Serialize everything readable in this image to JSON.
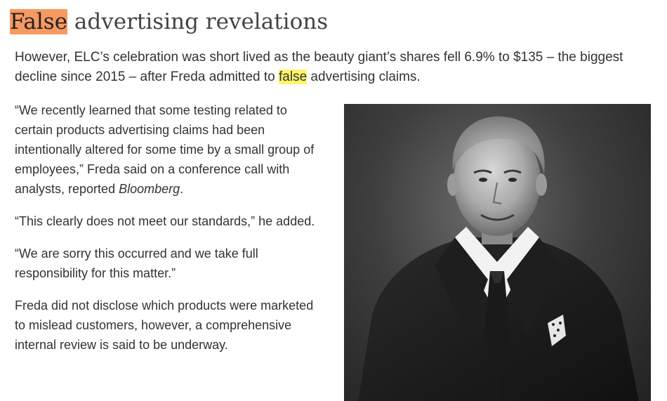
{
  "article": {
    "heading_highlight": "False",
    "heading_rest": " advertising revelations",
    "lead_before": "However, ELC’s celebration was short lived as the beauty giant’s shares fell 6.9% to $135 – the biggest decline since 2015 – after Freda admitted to ",
    "lead_highlight": "false",
    "lead_after": " advertising claims.",
    "quote1_text": "“We recently learned that some testing related to certain products advertising claims had been intentionally altered for some time by a small group of employees,” Freda said on a conference call with analysts, reported ",
    "quote1_source": "Bloomberg",
    "quote1_end": ".",
    "quote2": "“This clearly does not meet our standards,” he added.",
    "quote3": "“We are sorry this occurred and we take full responsibility for this matter.”",
    "closing": "Freda did not disclose which products were marketed to mislead customers, however, a comprehensive internal review is said to be underway."
  },
  "photo": {
    "subject": "black-and-white portrait of a smiling man in a dark suit and tie"
  }
}
